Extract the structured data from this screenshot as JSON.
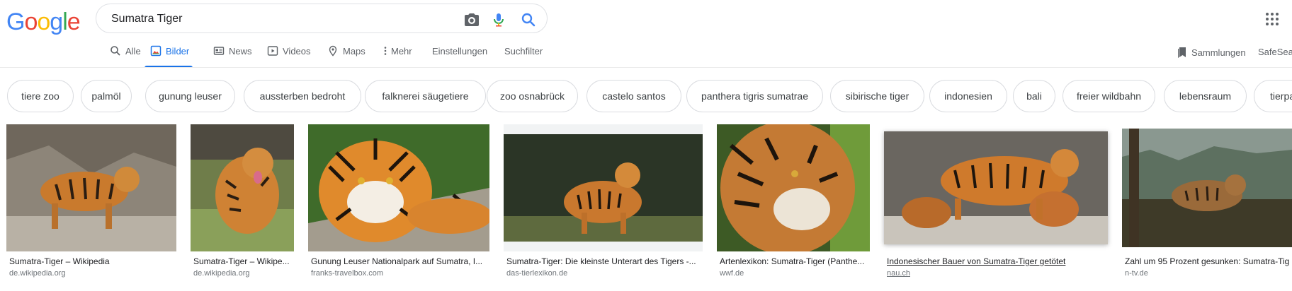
{
  "logo": {
    "text": [
      "G",
      "o",
      "o",
      "g",
      "l",
      "e"
    ],
    "colors": [
      "#4285f4",
      "#ea4335",
      "#fbbc05",
      "#4285f4",
      "#34a853",
      "#ea4335"
    ]
  },
  "search": {
    "query": "Sumatra Tiger",
    "placeholder": ""
  },
  "icons": {
    "camera": "camera-icon",
    "mic": "microphone-icon",
    "search": "search-icon",
    "apps": "apps-grid-icon"
  },
  "colors": {
    "accent": "#1a73e8",
    "chip_border": "#dadce0"
  },
  "tabs": [
    {
      "label": "Alle",
      "icon": "search-icon"
    },
    {
      "label": "Bilder",
      "icon": "image-icon",
      "active": true
    },
    {
      "label": "News",
      "icon": "news-icon"
    },
    {
      "label": "Videos",
      "icon": "play-icon"
    },
    {
      "label": "Maps",
      "icon": "map-pin-icon"
    },
    {
      "label": "Mehr",
      "icon": "more-vertical-icon"
    },
    {
      "label": "Einstellungen"
    },
    {
      "label": "Suchfilter"
    }
  ],
  "header_right": {
    "collections": "Sammlungen",
    "safesearch": "SafeSea"
  },
  "chips": [
    "tiere zoo",
    "palmöl",
    "gunung leuser",
    "aussterben bedroht",
    "falknerei säugetiere",
    "zoo osnabrück",
    "castelo santos",
    "panthera tigris sumatrae",
    "sibirische tiger",
    "indonesien",
    "bali",
    "freier wildbahn",
    "lebensraum",
    "tierpa"
  ],
  "results": [
    {
      "title": "Sumatra-Tiger – Wikipedia",
      "source": "de.wikipedia.org"
    },
    {
      "title": "Sumatra-Tiger – Wikipe...",
      "source": "de.wikipedia.org"
    },
    {
      "title": "Gunung Leuser Nationalpark auf Sumatra, I...",
      "source": "franks-travelbox.com"
    },
    {
      "title": "Sumatra-Tiger: Die kleinste Unterart des Tigers -...",
      "source": "das-tierlexikon.de"
    },
    {
      "title": "Artenlexikon: Sumatra-Tiger (Panthe...",
      "source": "wwf.de"
    },
    {
      "title": "Indonesischer Bauer von Sumatra-Tiger getötet",
      "source": "nau.ch",
      "hovered": true
    },
    {
      "title": "Zahl um 95 Prozent gesunken: Sumatra-Tig",
      "source": "n-tv.de"
    }
  ]
}
